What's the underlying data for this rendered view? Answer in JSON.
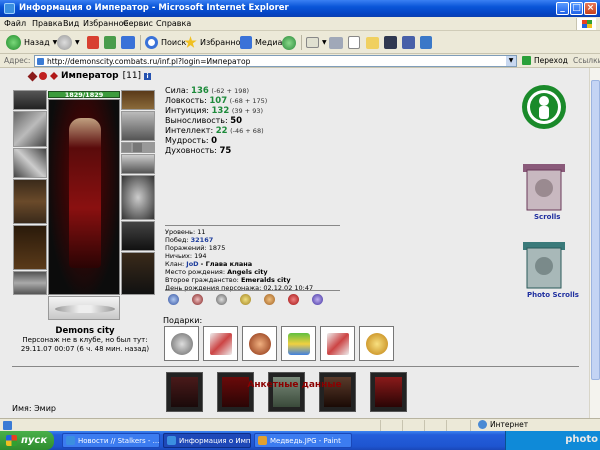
{
  "window": {
    "title": "Информация о Император - Microsoft Internet Explorer"
  },
  "menu": [
    "Файл",
    "Правка",
    "Вид",
    "Избранное",
    "Сервис",
    "Справка"
  ],
  "toolbar": {
    "back": "Назад",
    "search": "Поиск",
    "favorites": "Избранное",
    "media": "Медиа"
  },
  "address": {
    "label": "Адрес:",
    "url": "http://demonscity.combats.ru/inf.pl?login=Император",
    "go": "Переход",
    "links": "Ссылки"
  },
  "character": {
    "name": "Император",
    "level": "[11]",
    "hp": "1829/1829",
    "city": "Demons city",
    "offline_line1": "Персонаж не в клубе, но был тут:",
    "offline_line2": "29.11.07 00:07 (6 ч. 48 мин. назад)"
  },
  "stats": [
    {
      "label": "Сила:",
      "value": "136",
      "mod": "(-62 + 198)"
    },
    {
      "label": "Ловкость:",
      "value": "107",
      "mod": "(-68 + 175)"
    },
    {
      "label": "Интуиция:",
      "value": "132",
      "mod": "(39 + 93)"
    },
    {
      "label": "Выносливость:",
      "value": "50",
      "mod": ""
    },
    {
      "label": "Интеллект:",
      "value": "22",
      "mod": "(-46 + 68)"
    },
    {
      "label": "Мудрость:",
      "value": "0",
      "mod": ""
    },
    {
      "label": "Духовность:",
      "value": "75",
      "mod": ""
    }
  ],
  "details": {
    "level": "Уровень: 11",
    "wins_label": "Побед:",
    "wins": "32167",
    "losses": "Поражений: 1875",
    "draws": "Ничьих: 194",
    "clan_label": "Клан:",
    "clan": "JoD",
    "clan_rest": "- Глава клана",
    "birthplace_label": "Место рождения:",
    "birthplace": "Angels city",
    "second_label": "Второе гражданство:",
    "second": "Emeralds city",
    "birthday": "День рождения персонажа: 02.12.02 10:47"
  },
  "gifts_label": "Подарки:",
  "section_title": "Анкетные данные",
  "name_row": "Имя:  Эмир",
  "side": {
    "scrolls": "Scrolls",
    "photo_scrolls": "Photo Scrolls"
  },
  "status": {
    "zone": "Интернет"
  },
  "taskbar": {
    "start": "пуск",
    "tasks": [
      "Новости // Stalkers - ...",
      "Информация о Импе...",
      "Медведь.JPG - Paint"
    ]
  },
  "watermark": "photo"
}
